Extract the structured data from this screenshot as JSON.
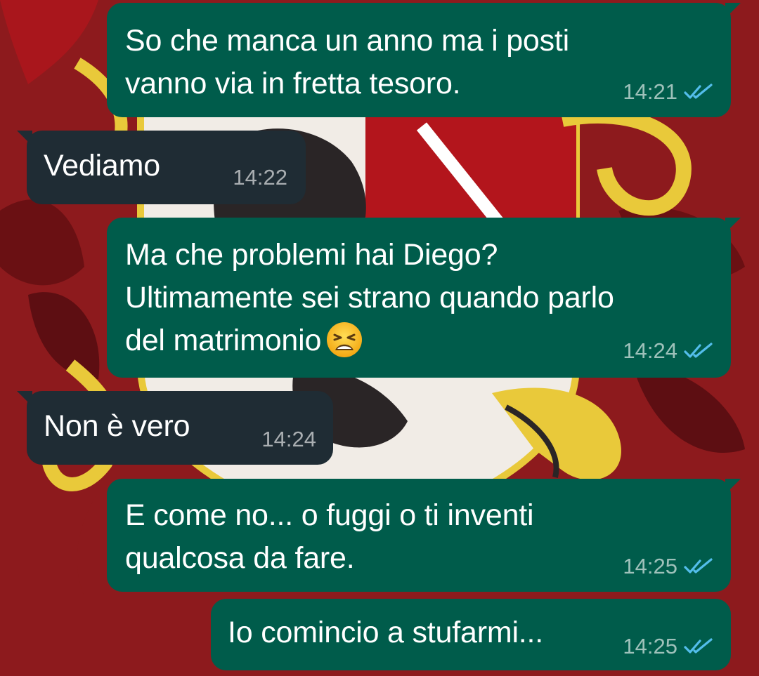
{
  "chat": {
    "messages": [
      {
        "direction": "outgoing",
        "text": "So che manca un anno ma i posti\nvanno via in fretta tesoro.",
        "time": "14:21",
        "status": "read"
      },
      {
        "direction": "incoming",
        "text": "Vediamo",
        "time": "14:22"
      },
      {
        "direction": "outgoing",
        "text": "Ma che problemi hai Diego?\nUltimamente sei strano quando parlo\ndel matrimonio",
        "emoji": "weary-face-emoji",
        "time": "14:24",
        "status": "read"
      },
      {
        "direction": "incoming",
        "text": "Non è vero",
        "time": "14:24"
      },
      {
        "direction": "outgoing",
        "text": "E come no... o fuggi o ti inventi\nqualcosa da fare.",
        "time": "14:25",
        "status": "read"
      },
      {
        "direction": "outgoing",
        "text": "Io comincio a stufarmi...",
        "time": "14:25",
        "status": "read"
      }
    ]
  },
  "icons": {
    "read_receipt": "double-check-icon",
    "wallpaper": "heraldic-crest"
  },
  "colors": {
    "outgoing_bubble": "#005c4b",
    "incoming_bubble": "#1f2c34",
    "read_tick": "#53bdeb",
    "wallpaper_red": "#8d1a1d",
    "wallpaper_gold": "#e9c93a"
  }
}
